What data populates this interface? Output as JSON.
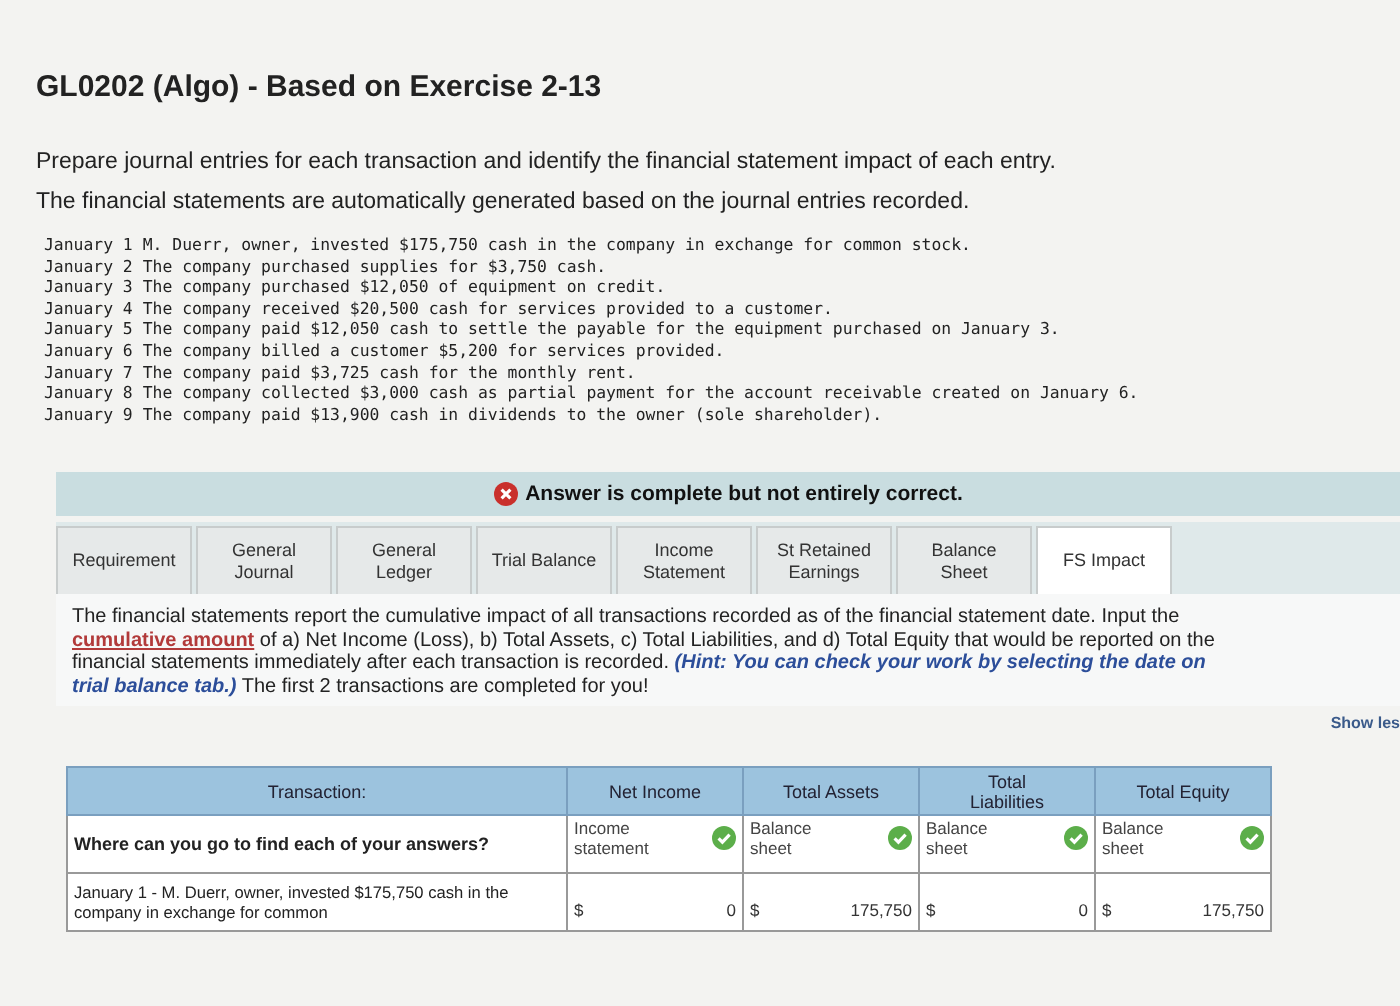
{
  "title": "GL0202 (Algo) - Based on Exercise 2-13",
  "instructions": [
    "Prepare journal entries for each transaction and identify the financial statement impact of each entry.",
    "The financial statements are automatically generated based on the journal entries recorded."
  ],
  "transactions": [
    {
      "date": "January 1",
      "text": "M. Duerr, owner, invested $175,750 cash in the company in exchange for common stock."
    },
    {
      "date": "January 2",
      "text": "The company purchased supplies for $3,750 cash."
    },
    {
      "date": "January 3",
      "text": "The company purchased $12,050 of equipment on credit."
    },
    {
      "date": "January 4",
      "text": "The company received $20,500 cash for services provided to a customer."
    },
    {
      "date": "January 5",
      "text": "The company paid $12,050 cash to settle the payable for the equipment purchased on January 3."
    },
    {
      "date": "January 6",
      "text": "The company billed a customer $5,200 for services provided."
    },
    {
      "date": "January 7",
      "text": "The company paid $3,725 cash for the monthly rent."
    },
    {
      "date": "January 8",
      "text": "The company collected $3,000 cash as partial payment for the account receivable created on January 6."
    },
    {
      "date": "January 9",
      "text": "The company paid $13,900 cash in dividends to the owner (sole shareholder)."
    }
  ],
  "banner": {
    "correct": false,
    "message": "Answer is complete but not entirely correct."
  },
  "tabs": [
    {
      "label": "Requirement",
      "selected": false
    },
    {
      "label": "General Journal",
      "selected": false
    },
    {
      "label": "General Ledger",
      "selected": false
    },
    {
      "label": "Trial Balance",
      "selected": false
    },
    {
      "label": "Income Statement",
      "selected": false
    },
    {
      "label": "St Retained Earnings",
      "selected": false
    },
    {
      "label": "Balance Sheet",
      "selected": false
    },
    {
      "label": "FS Impact",
      "selected": true
    }
  ],
  "description_lines": [
    "The financial statements report the cumulative impact of all transactions recorded as of the financial statement date. Input the",
    "**cumulative amount** of a) Net Income (Loss), b) Total Assets, c) Total Liabilities, and d) Total Equity that would be reported on the",
    "financial statements immediately after each transaction is recorded. *(Hint: You can check your work by selecting the date on*",
    "*trial balance tab.)* The first 2 transactions are completed for you!"
  ],
  "show_less": "Show les",
  "table": {
    "columns": [
      "Transaction:",
      "Net Income",
      "Total Assets",
      "Total Liabilities",
      "Total Equity"
    ],
    "rows": [
      {
        "kind": "source",
        "cells": [
          {
            "text": "Where can you go to find each of your answers?"
          },
          {
            "text": "Income statement",
            "correct": true
          },
          {
            "text": "Balance sheet",
            "correct": true
          },
          {
            "text": "Balance sheet",
            "correct": true
          },
          {
            "text": "Balance sheet",
            "correct": true
          }
        ]
      },
      {
        "kind": "amount",
        "cells": [
          {
            "text": "January 1 - M. Duerr, owner, invested $175,750 cash in the company in exchange for common"
          },
          {
            "currency": "$",
            "value": "0"
          },
          {
            "currency": "$",
            "value": "175,750"
          },
          {
            "currency": "$",
            "value": "0"
          },
          {
            "currency": "$",
            "value": "175,750"
          }
        ]
      }
    ]
  }
}
